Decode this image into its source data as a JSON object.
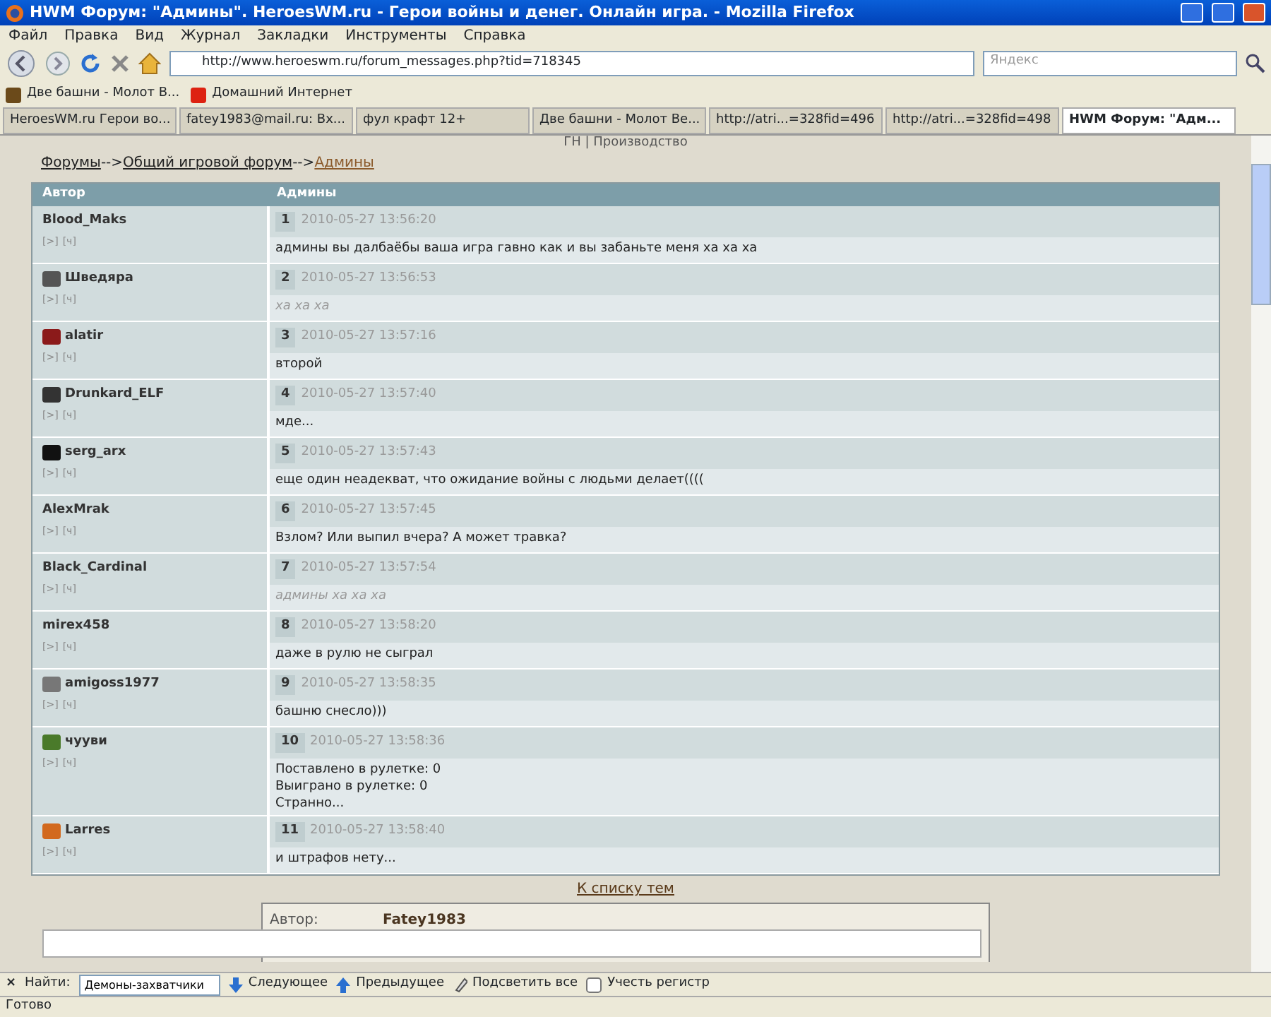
{
  "window": {
    "title": "HWM Форум: \"Админы\". HeroesWM.ru - Герои войны и денег. Онлайн игра. - Mozilla Firefox"
  },
  "menu": [
    "Файл",
    "Правка",
    "Вид",
    "Журнал",
    "Закладки",
    "Инструменты",
    "Справка"
  ],
  "address": "http://www.heroeswm.ru/forum_messages.php?tid=718345",
  "search": {
    "placeholder": "Яндекс"
  },
  "bookmarks": [
    "Две башни - Молот В...",
    "Домашний Интернет"
  ],
  "tabs": [
    {
      "label": "HeroesWM.ru Герои во...",
      "selected": false
    },
    {
      "label": "fatey1983@mail.ru: Вх...",
      "selected": false
    },
    {
      "label": "фул крафт 12+",
      "selected": false
    },
    {
      "label": "Две башни - Молот Ве...",
      "selected": false
    },
    {
      "label": "http://atri...=328fid=496",
      "selected": false
    },
    {
      "label": "http://atri...=328fid=498",
      "selected": false
    },
    {
      "label": "HWM Форум: \"Адм...",
      "selected": true
    }
  ],
  "top_links": "ГН | Производство",
  "breadcrumb": [
    "Форумы",
    "-->",
    "Общий игровой форум",
    "-->",
    "Админы"
  ],
  "table": {
    "columns": [
      "Автор",
      "Админы"
    ],
    "rows": [
      {
        "author": "Blood_Maks",
        "icon": false,
        "links": [
          "[>]",
          "[ч]"
        ],
        "number": "1",
        "time": "2010-05-27 13:56:20",
        "text": "админы вы далбаёбы ваша игра гавно как и вы забаньте меня ха ха ха",
        "greyed": false
      },
      {
        "author": "Шведяра",
        "icon": true,
        "color": "#555555",
        "links": [
          "[>]",
          "[ч]"
        ],
        "number": "2",
        "time": "2010-05-27 13:56:53",
        "text": "ха ха ха",
        "greyed": true
      },
      {
        "author": "alatir",
        "icon": true,
        "color": "#8b1a1a",
        "links": [
          "[>]",
          "[ч]"
        ],
        "number": "3",
        "time": "2010-05-27 13:57:16",
        "text": "второй",
        "greyed": false
      },
      {
        "author": "Drunkard_ELF",
        "icon": true,
        "color": "#333333",
        "links": [
          "[>]",
          "[ч]"
        ],
        "number": "4",
        "time": "2010-05-27 13:57:40",
        "text": "мде...",
        "greyed": false
      },
      {
        "author": "serg_arx",
        "icon": true,
        "color": "#111111",
        "links": [
          "[>]",
          "[ч]"
        ],
        "number": "5",
        "time": "2010-05-27 13:57:43",
        "text": "еще один неадекват, что ожидание войны с людьми делает((((",
        "greyed": false
      },
      {
        "author": "AlexMrak",
        "icon": false,
        "links": [
          "[>]",
          "[ч]"
        ],
        "number": "6",
        "time": "2010-05-27 13:57:45",
        "text": "Взлом? Или выпил вчера? А может травка?",
        "greyed": false
      },
      {
        "author": "Black_Cardinal",
        "icon": false,
        "links": [
          "[>]",
          "[ч]"
        ],
        "number": "7",
        "time": "2010-05-27 13:57:54",
        "text": "админы ха ха ха",
        "greyed": true
      },
      {
        "author": "mirex458",
        "icon": false,
        "links": [
          "[>]",
          "[ч]"
        ],
        "number": "8",
        "time": "2010-05-27 13:58:20",
        "text": "даже в рулю не сыграл",
        "greyed": false
      },
      {
        "author": "amigoss1977",
        "icon": true,
        "color": "#777777",
        "links": [
          "[>]",
          "[ч]"
        ],
        "number": "9",
        "time": "2010-05-27 13:58:35",
        "text": "башню снесло)))",
        "greyed": false
      },
      {
        "author": "чууви",
        "icon": true,
        "color": "#4a7a2a",
        "links": [
          "[>]",
          "[ч]"
        ],
        "number": "10",
        "time": "2010-05-27 13:58:36",
        "text": "Поставлено в рулетке: 0\nВыиграно в рулетке: 0\nСтранно...",
        "greyed": false
      },
      {
        "author": "Larres",
        "icon": true,
        "color": "#d2691e",
        "links": [
          "[>]",
          "[ч]"
        ],
        "number": "11",
        "time": "2010-05-27 13:58:40",
        "text": "и штрафов нету...",
        "greyed": false
      }
    ]
  },
  "back_link": "К списку тем",
  "reply": {
    "label": "Автор:",
    "author": "Fatey1983"
  },
  "find_bar": {
    "close": "×",
    "label": "Найти:",
    "value": "Демоны-захватчики",
    "next": "Следующее",
    "prev": "Предыдущее",
    "highlight": "Подсветить все",
    "match_case": {
      "label": "Учесть регистр",
      "checked": false
    }
  },
  "status_bar": "Готово"
}
